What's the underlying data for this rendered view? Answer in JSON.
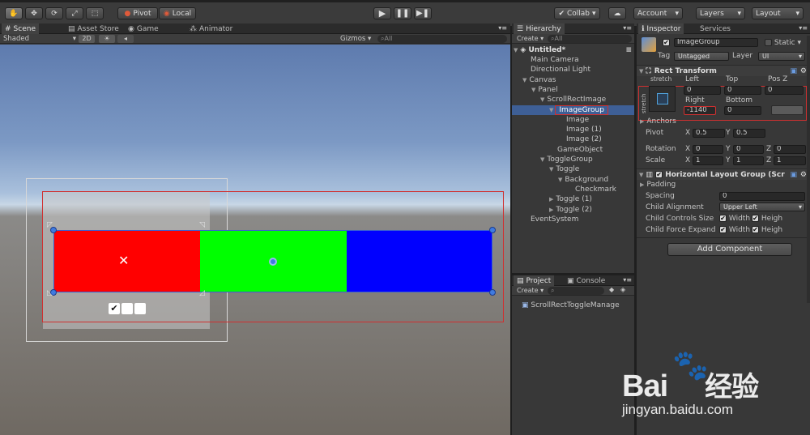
{
  "toolbar": {
    "tool_icons": [
      "hand-icon",
      "move-icon",
      "rotate-icon",
      "scale-icon",
      "rect-icon"
    ],
    "pivot_label": "Pivot",
    "local_label": "Local",
    "collab_label": "Collab",
    "account_label": "Account",
    "layers_label": "Layers",
    "layout_label": "Layout"
  },
  "scene": {
    "tabs": [
      {
        "label": "Scene",
        "icon": "grid-icon"
      },
      {
        "label": "Asset Store",
        "icon": "store-icon"
      },
      {
        "label": "Game",
        "icon": "gamepad-icon"
      },
      {
        "label": "Animator",
        "icon": "animator-icon"
      }
    ],
    "shading_mode": "Shaded",
    "mode_2d": "2D",
    "gizmos_label": "Gizmos",
    "search_placeholder": "All",
    "colors": {
      "red": "#ff0000",
      "green": "#00ff00",
      "blue": "#0000ff",
      "sky": "#9fb8d4",
      "ground": "#6f6962"
    }
  },
  "hierarchy": {
    "tab_label": "Hierarchy",
    "create_label": "Create",
    "search_placeholder": "All",
    "scene_name": "Untitled*",
    "items": [
      {
        "label": "Main Camera",
        "depth": 1,
        "arrow": ""
      },
      {
        "label": "Directional Light",
        "depth": 1,
        "arrow": ""
      },
      {
        "label": "Canvas",
        "depth": 1,
        "arrow": "▼"
      },
      {
        "label": "Panel",
        "depth": 2,
        "arrow": "▼"
      },
      {
        "label": "ScrollRectImage",
        "depth": 3,
        "arrow": "▼"
      },
      {
        "label": "ImageGroup",
        "depth": 4,
        "arrow": "▼",
        "selected": true
      },
      {
        "label": "Image",
        "depth": 5,
        "arrow": ""
      },
      {
        "label": "Image (1)",
        "depth": 5,
        "arrow": ""
      },
      {
        "label": "Image (2)",
        "depth": 5,
        "arrow": ""
      },
      {
        "label": "GameObject",
        "depth": 4,
        "arrow": ""
      },
      {
        "label": "ToggleGroup",
        "depth": 3,
        "arrow": "▼"
      },
      {
        "label": "Toggle",
        "depth": 4,
        "arrow": "▼"
      },
      {
        "label": "Background",
        "depth": 5,
        "arrow": "▼"
      },
      {
        "label": "Checkmark",
        "depth": 6,
        "arrow": ""
      },
      {
        "label": "Toggle (1)",
        "depth": 4,
        "arrow": "▶"
      },
      {
        "label": "Toggle (2)",
        "depth": 4,
        "arrow": "▶"
      },
      {
        "label": "EventSystem",
        "depth": 1,
        "arrow": ""
      }
    ]
  },
  "project": {
    "tabs": [
      {
        "label": "Project"
      },
      {
        "label": "Console"
      }
    ],
    "create_label": "Create",
    "items": [
      {
        "label": "ScrollRectToggleManage"
      }
    ]
  },
  "inspector": {
    "tabs": [
      {
        "label": "Inspector"
      },
      {
        "label": "Services"
      }
    ],
    "object_name": "ImageGroup",
    "static_label": "Static",
    "tag_label": "Tag",
    "tag_value": "Untagged",
    "layer_label": "Layer",
    "layer_value": "UI",
    "rect_transform": {
      "title": "Rect Transform",
      "anchor_preset": "stretch",
      "side_label": "stretch",
      "left_label": "Left",
      "left_value": "0",
      "top_label": "Top",
      "top_value": "0",
      "posz_label": "Pos Z",
      "posz_value": "0",
      "right_label": "Right",
      "right_value": "-1140",
      "bottom_label": "Bottom",
      "bottom_value": "0",
      "anchors_label": "Anchors",
      "pivot_label": "Pivot",
      "pivot_x": "0.5",
      "pivot_y": "0.5",
      "rotation_label": "Rotation",
      "rot_x": "0",
      "rot_y": "0",
      "rot_z": "0",
      "scale_label": "Scale",
      "scale_x": "1",
      "scale_y": "1",
      "scale_z": "1"
    },
    "layout_group": {
      "title": "Horizontal Layout Group (Scr",
      "padding_label": "Padding",
      "spacing_label": "Spacing",
      "spacing_value": "0",
      "alignment_label": "Child Alignment",
      "alignment_value": "Upper Left",
      "controls_label": "Child Controls Size",
      "expand_label": "Child Force Expand",
      "width_label": "Width",
      "height_label": "Heigh"
    },
    "add_component_label": "Add Component"
  },
  "watermark": {
    "brand": "Bai",
    "brand2": "经验",
    "url": "jingyan.baidu.com"
  }
}
